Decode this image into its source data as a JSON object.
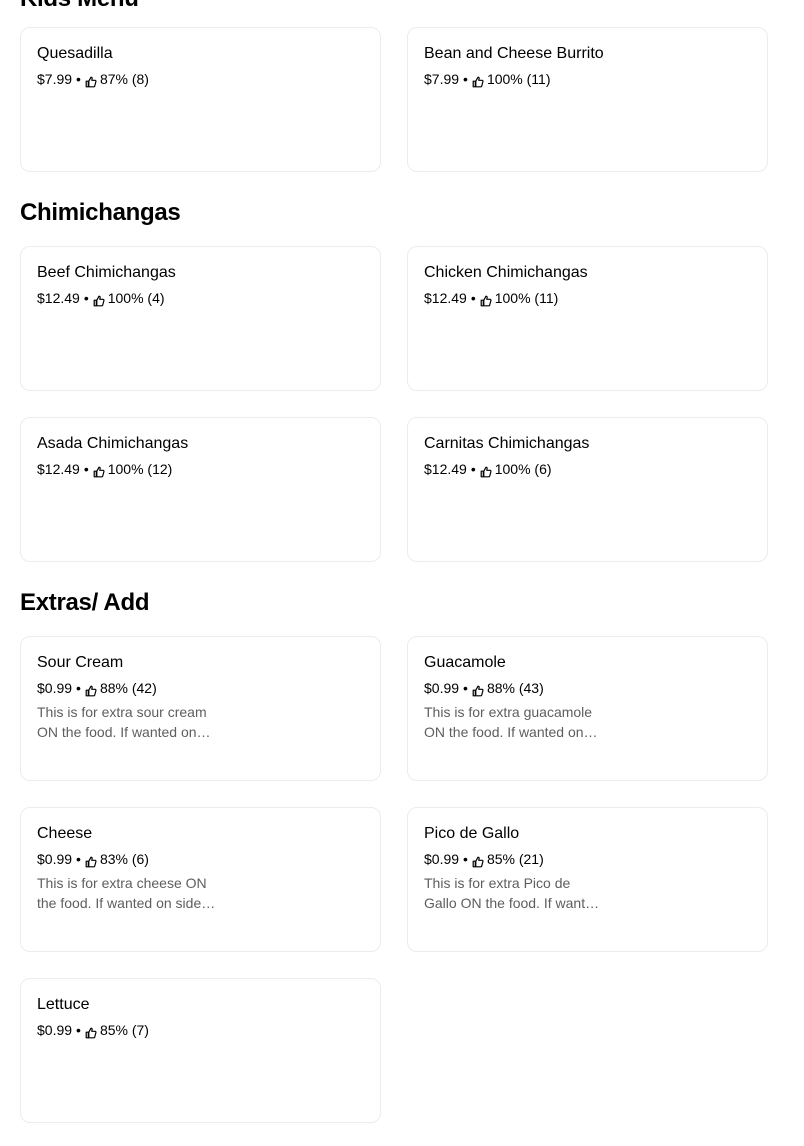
{
  "sections": [
    {
      "title": "Kids Menu",
      "items": [
        {
          "name": "Quesadilla",
          "price": "$7.99",
          "rating": "87% (8)",
          "desc": ""
        },
        {
          "name": "Bean and Cheese Burrito",
          "price": "$7.99",
          "rating": "100% (11)",
          "desc": ""
        }
      ]
    },
    {
      "title": "Chimichangas",
      "items": [
        {
          "name": "Beef Chimichangas",
          "price": "$12.49",
          "rating": "100% (4)",
          "desc": ""
        },
        {
          "name": "Chicken Chimichangas",
          "price": "$12.49",
          "rating": "100% (11)",
          "desc": ""
        },
        {
          "name": "Asada Chimichangas",
          "price": "$12.49",
          "rating": "100% (12)",
          "desc": ""
        },
        {
          "name": "Carnitas Chimichangas",
          "price": "$12.49",
          "rating": "100% (6)",
          "desc": ""
        }
      ]
    },
    {
      "title": "Extras/ Add",
      "items": [
        {
          "name": "Sour Cream",
          "price": "$0.99",
          "rating": "88% (42)",
          "desc": "This is for extra sour cream ON the food. If wanted on side, add a side order."
        },
        {
          "name": "Guacamole",
          "price": "$0.99",
          "rating": "88% (43)",
          "desc": "This is for extra guacamole ON the food. If wanted on side, add a side order."
        },
        {
          "name": "Cheese",
          "price": "$0.99",
          "rating": "83% (6)",
          "desc": "This is for extra cheese ON the food. If wanted on side, add a side order."
        },
        {
          "name": "Pico de Gallo",
          "price": "$0.99",
          "rating": "85% (21)",
          "desc": "This is for extra Pico de Gallo ON the food. If wanted on side, add a side order."
        },
        {
          "name": "Lettuce",
          "price": "$0.99",
          "rating": "85% (7)",
          "desc": ""
        }
      ]
    }
  ],
  "separator": "•",
  "icons": {
    "rating": "thumbs-up-icon"
  },
  "colors": {
    "text": "#000000",
    "muted": "#5e5e5e",
    "border": "#ececec",
    "background": "#ffffff"
  }
}
